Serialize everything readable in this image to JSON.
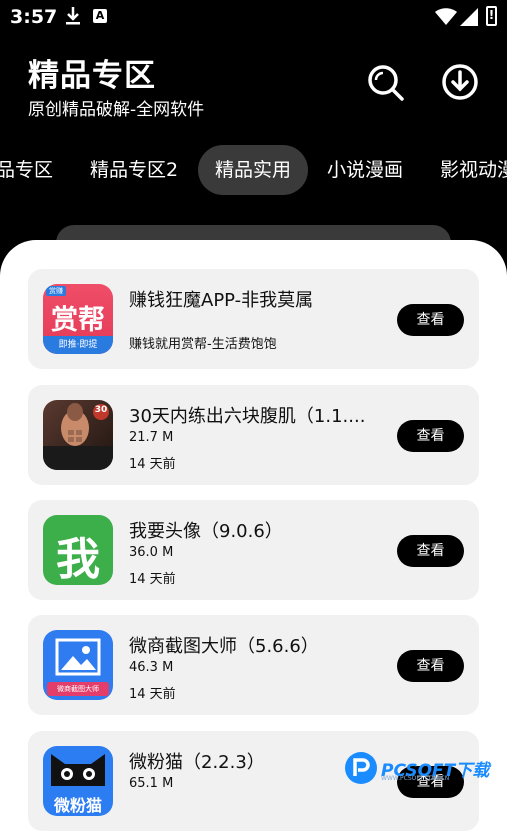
{
  "status": {
    "time": "3:57",
    "battery_glyph": "!"
  },
  "header": {
    "title": "精品专区",
    "subtitle": "原创精品破解-全网软件"
  },
  "tabs": [
    {
      "label": "品专区"
    },
    {
      "label": "精品专区2"
    },
    {
      "label": "精品实用",
      "active": true
    },
    {
      "label": "小说漫画"
    },
    {
      "label": "影视动漫"
    }
  ],
  "apps": [
    {
      "name": "赚钱狂魔APP-非我莫属",
      "desc": "赚钱就用赏帮-生活费饱饱",
      "button": "查看",
      "icon": "shangbang-icon",
      "icon_text": "赏帮",
      "icon_sub": "即推·即提",
      "icon_tag": "赏赚"
    },
    {
      "name": "30天内练出六块腹肌（1.1....",
      "size": "21.7 M",
      "date": "14 天前",
      "button": "查看",
      "icon": "abs-workout-icon",
      "icon_tag": "30"
    },
    {
      "name": "我要头像（9.0.6）",
      "size": "36.0 M",
      "date": "14 天前",
      "button": "查看",
      "icon": "avatar-app-icon",
      "icon_text": "我"
    },
    {
      "name": "微商截图大师（5.6.6）",
      "size": "46.3 M",
      "date": "14 天前",
      "button": "查看",
      "icon": "screenshot-master-icon",
      "icon_sub": "微商截图大师"
    },
    {
      "name": "微粉猫（2.2.3）",
      "size": "65.1 M",
      "button": "查看",
      "icon": "weifenmao-icon",
      "icon_text": "微粉猫"
    }
  ],
  "watermark": {
    "text": "PCSOFT下载",
    "sub": "WWW.PCSOFT.COM.CN"
  },
  "colors": {
    "accent": "#000000",
    "card": "#f1f1f1",
    "active_tab": "#3a3a3a"
  }
}
